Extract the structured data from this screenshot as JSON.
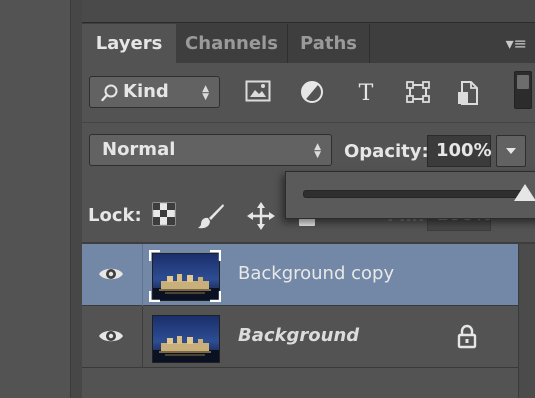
{
  "tabs": {
    "layers": "Layers",
    "channels": "Channels",
    "paths": "Paths"
  },
  "panel_menu_glyph": "▾≡",
  "filter": {
    "kind_label": "Kind",
    "icons": [
      "pixel-layer-filter-icon",
      "adjustment-layer-filter-icon",
      "type-layer-filter-icon",
      "shape-layer-filter-icon",
      "smart-object-filter-icon"
    ],
    "type_glyph": "T"
  },
  "blend": {
    "mode": "Normal"
  },
  "opacity": {
    "label": "Opacity:",
    "value": "100%",
    "slider_fraction": 1.0
  },
  "lock": {
    "label": "Lock:",
    "icons": [
      "lock-transparent-pixels-icon",
      "lock-image-pixels-icon",
      "lock-position-icon",
      "lock-all-icon"
    ]
  },
  "fill": {
    "label": "Fill:",
    "value": "100%"
  },
  "layers": [
    {
      "name": "Background copy",
      "selected": true,
      "visible": true,
      "locked": false,
      "italic": false
    },
    {
      "name": "Background",
      "selected": false,
      "visible": true,
      "locked": true,
      "italic": true
    }
  ],
  "colors": {
    "panel_bg": "#535353",
    "selected_row": "#7388a6",
    "text": "#e6e6e6"
  }
}
